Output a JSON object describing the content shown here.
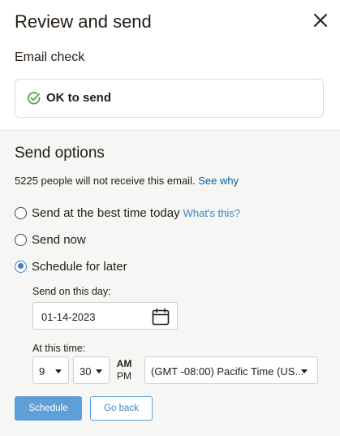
{
  "header": {
    "title": "Review and send"
  },
  "email_check": {
    "section_label": "Email check",
    "status_text": "OK to send",
    "status_icon": "check-circle-icon",
    "status_color": "#54a34a"
  },
  "send_options": {
    "title": "Send options",
    "notice_text": "5225 people will not receive this email.",
    "notice_link": "See why",
    "options": [
      {
        "label": "Send at the best time today",
        "hint": "What's this?",
        "checked": false
      },
      {
        "label": "Send now",
        "checked": false
      },
      {
        "label": "Schedule for later",
        "checked": true
      }
    ],
    "day_label": "Send on this day:",
    "date_value": "01-14-2023",
    "time_label": "At this time:",
    "hour": "9",
    "minute": "30",
    "am": "AM",
    "pm": "PM",
    "timezone": "(GMT -08:00) Pacific Time (US..."
  },
  "actions": {
    "schedule_label": "Schedule",
    "back_label": "Go back"
  },
  "colors": {
    "accent": "#5f9fd8",
    "link": "#0d5e9d",
    "background_bottom": "#f6f6f4"
  }
}
